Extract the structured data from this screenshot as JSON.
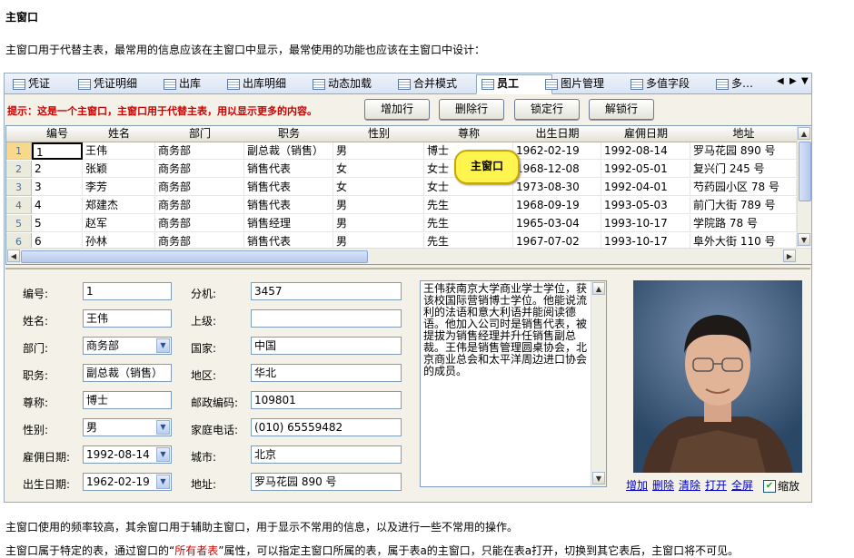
{
  "doc": {
    "title": "主窗口",
    "intro": "主窗口用于代替主表，最常用的信息应该在主窗口中显示，最常使用的功能也应该在主窗口中设计：",
    "footer1": "主窗口使用的频率较高，其余窗口用于辅助主窗口，用于显示不常用的信息，以及进行一些不常用的操作。",
    "footer2_pre": "主窗口属于特定的表，通过窗口的“",
    "footer2_link": "所有者表",
    "footer2_post": "”属性，可以指定主窗口所属的表，属于表a的主窗口，只能在表a打开，切换到其它表后，主窗口将不可见。"
  },
  "tabs": [
    {
      "label": "凭证"
    },
    {
      "label": "凭证明细"
    },
    {
      "label": "出库"
    },
    {
      "label": "出库明细"
    },
    {
      "label": "动态加载"
    },
    {
      "label": "合并模式"
    },
    {
      "label": "员工"
    },
    {
      "label": "图片管理"
    },
    {
      "label": "多值字段"
    },
    {
      "label": "多…"
    }
  ],
  "toolbar": {
    "hint": "提示：这是一个主窗口，主窗口用于代替主表，用以显示更多的内容。",
    "add_row": "增加行",
    "delete_row": "删除行",
    "lock_row": "锁定行",
    "unlock_row": "解锁行"
  },
  "grid": {
    "columns": [
      "编号",
      "姓名",
      "部门",
      "职务",
      "性别",
      "尊称",
      "出生日期",
      "雇佣日期",
      "地址"
    ],
    "row_numbers": [
      "1",
      "2",
      "3",
      "4",
      "5",
      "6"
    ],
    "rows": [
      [
        "1",
        "王伟",
        "商务部",
        "副总裁（销售）",
        "男",
        "博士",
        "1962-02-19",
        "1992-08-14",
        "罗马花园 890 号"
      ],
      [
        "2",
        "张颖",
        "商务部",
        "销售代表",
        "女",
        "女士",
        "1968-12-08",
        "1992-05-01",
        "复兴门 245 号"
      ],
      [
        "3",
        "李芳",
        "商务部",
        "销售代表",
        "女",
        "女士",
        "1973-08-30",
        "1992-04-01",
        "芍药园小区 78 号"
      ],
      [
        "4",
        "郑建杰",
        "商务部",
        "销售代表",
        "男",
        "先生",
        "1968-09-19",
        "1993-05-03",
        "前门大街 789 号"
      ],
      [
        "5",
        "赵军",
        "商务部",
        "销售经理",
        "男",
        "先生",
        "1965-03-04",
        "1993-10-17",
        "学院路 78 号"
      ],
      [
        "6",
        "孙林",
        "商务部",
        "销售代表",
        "男",
        "先生",
        "1967-07-02",
        "1993-10-17",
        "阜外大街 110 号"
      ]
    ],
    "tooltip": "主窗口"
  },
  "form": {
    "labels": {
      "id": "编号:",
      "name": "姓名:",
      "dept": "部门:",
      "title": "职务:",
      "honorific": "尊称:",
      "gender": "性别:",
      "hire_date": "雇佣日期:",
      "birth_date": "出生日期:",
      "ext": "分机:",
      "boss": "上级:",
      "country": "国家:",
      "region": "地区:",
      "zip": "邮政编码:",
      "phone": "家庭电话:",
      "city": "城市:",
      "address": "地址:"
    },
    "values": {
      "id": "1",
      "name": "王伟",
      "dept": "商务部",
      "title": "副总裁（销售）",
      "honorific": "博士",
      "gender": "男",
      "hire_date": "1992-08-14",
      "birth_date": "1962-02-19",
      "ext": "3457",
      "boss": "",
      "country": "中国",
      "region": "华北",
      "zip": "109801",
      "phone": "(010) 65559482",
      "city": "北京",
      "address": "罗马花园 890 号"
    },
    "notes": "王伟获南京大学商业学士学位，获该校国际营销博士学位。他能说流利的法语和意大利语并能阅读德语。他加入公司时是销售代表，被提拔为销售经理并升任销售副总裁。王伟是销售管理圆桌协会，北京商业总会和太平洋周边进口协会的成员。"
  },
  "photo_actions": {
    "add": "增加",
    "delete": "删除",
    "clear": "清除",
    "open": "打开",
    "fullscreen": "全屏",
    "zoom": "缩放"
  }
}
